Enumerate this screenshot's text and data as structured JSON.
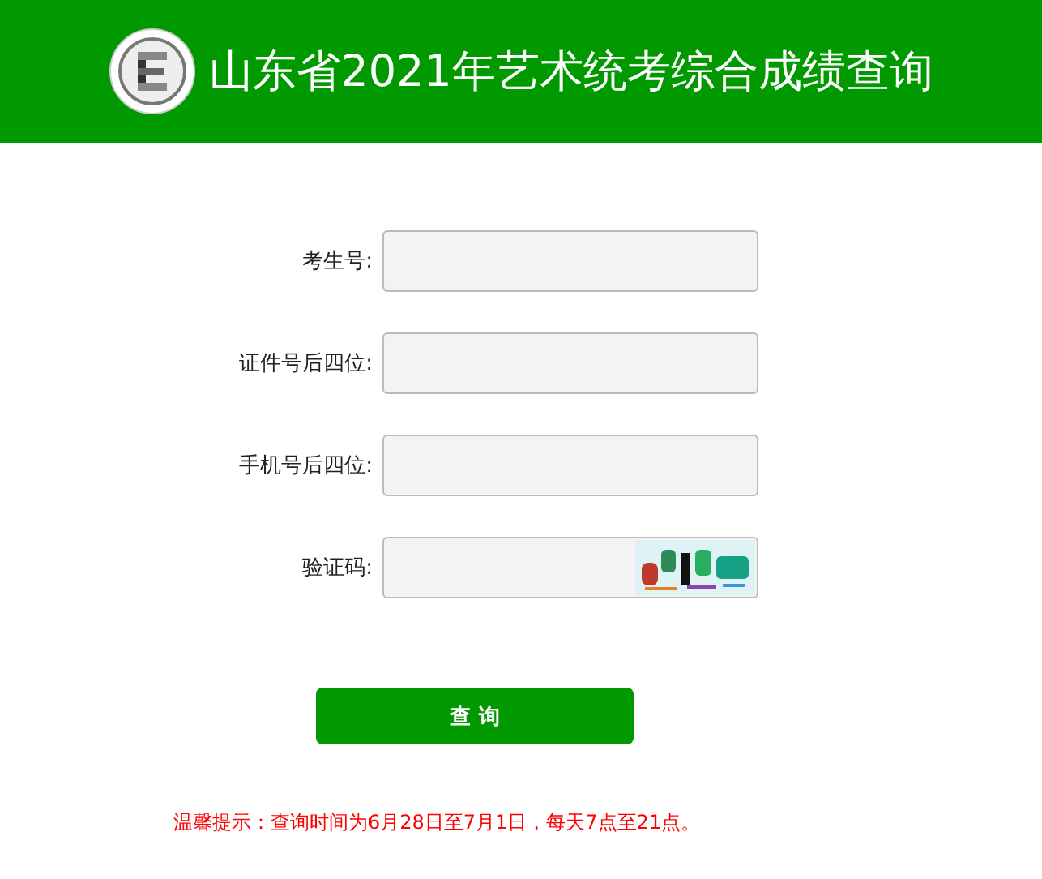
{
  "header": {
    "title": "山东省2021年艺术统考综合成绩查询"
  },
  "fields": [
    {
      "kind": "text",
      "label": "考生号:"
    },
    {
      "kind": "text",
      "label": "证件号后四位:"
    },
    {
      "kind": "text",
      "label": "手机号后四位:"
    },
    {
      "kind": "captcha",
      "label": "验证码:"
    }
  ],
  "submit": "查 询",
  "notice": "温馨提示：查询时间为6月28日至7月1日，每天7点至21点。"
}
